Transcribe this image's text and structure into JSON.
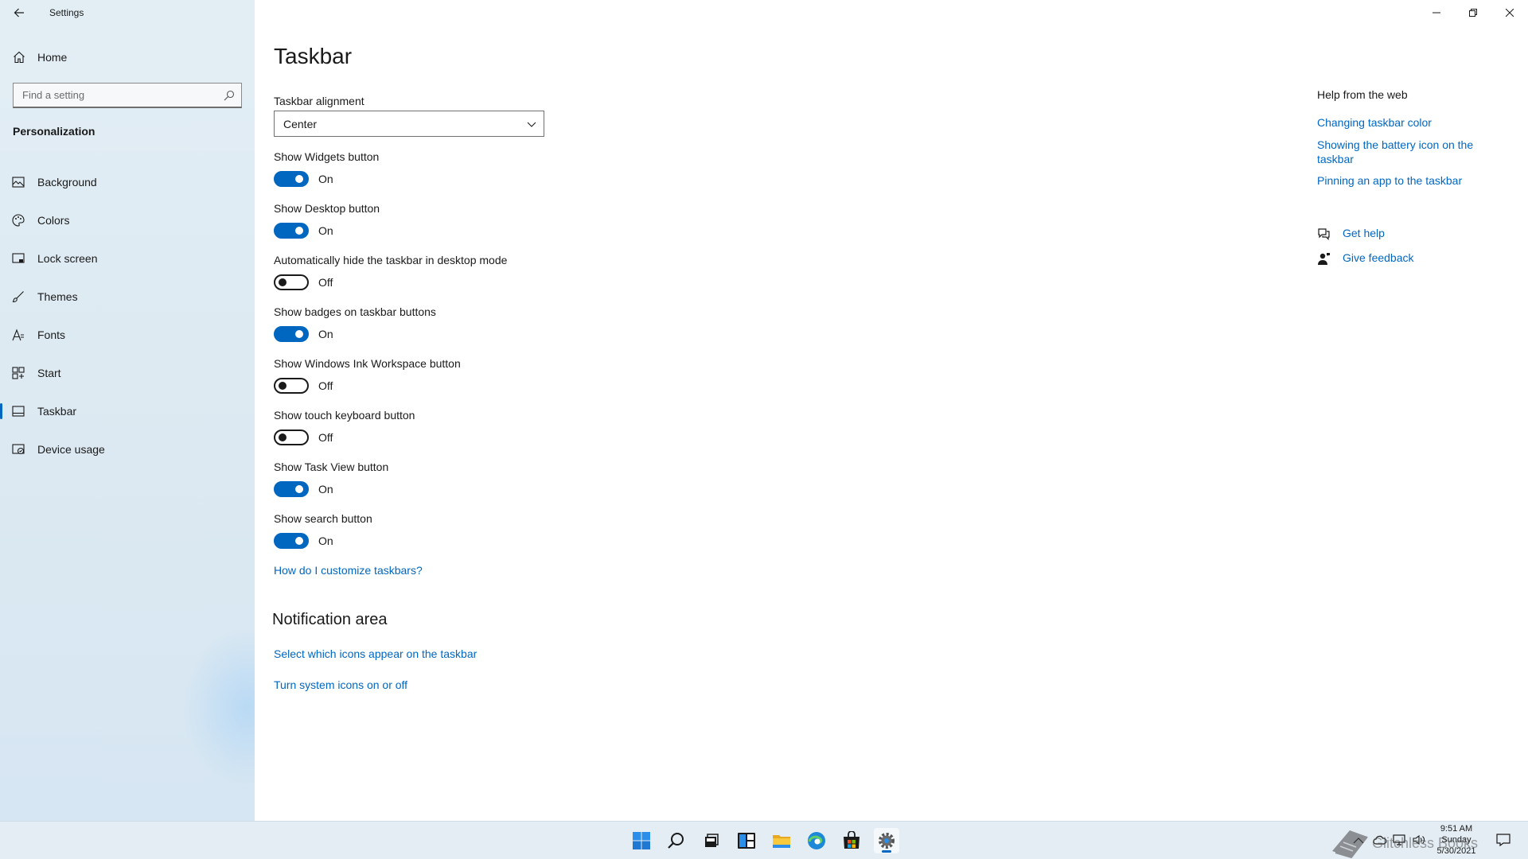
{
  "app": {
    "title": "Settings"
  },
  "sidebar": {
    "home_label": "Home",
    "search_placeholder": "Find a setting",
    "section": "Personalization",
    "items": [
      {
        "label": "Background",
        "icon": "picture-icon"
      },
      {
        "label": "Colors",
        "icon": "palette-icon"
      },
      {
        "label": "Lock screen",
        "icon": "lock-screen-icon"
      },
      {
        "label": "Themes",
        "icon": "brush-icon"
      },
      {
        "label": "Fonts",
        "icon": "font-icon"
      },
      {
        "label": "Start",
        "icon": "start-icon"
      },
      {
        "label": "Taskbar",
        "icon": "taskbar-icon",
        "selected": true
      },
      {
        "label": "Device usage",
        "icon": "device-usage-icon"
      }
    ]
  },
  "main": {
    "title": "Taskbar",
    "alignment": {
      "label": "Taskbar alignment",
      "value": "Center"
    },
    "toggles": [
      {
        "label": "Show Widgets button",
        "state": "On"
      },
      {
        "label": "Show Desktop button",
        "state": "On"
      },
      {
        "label": "Automatically hide the taskbar in desktop mode",
        "state": "Off"
      },
      {
        "label": "Show badges on taskbar buttons",
        "state": "On"
      },
      {
        "label": "Show Windows Ink Workspace button",
        "state": "Off"
      },
      {
        "label": "Show touch keyboard button",
        "state": "Off"
      },
      {
        "label": "Show Task View button",
        "state": "On"
      },
      {
        "label": "Show search button",
        "state": "On"
      }
    ],
    "customize_link": "How do I customize taskbars?",
    "notification": {
      "title": "Notification area",
      "links": [
        "Select which icons appear on the taskbar",
        "Turn system icons on or off"
      ]
    }
  },
  "help": {
    "title": "Help from the web",
    "links": [
      "Changing taskbar color",
      "Showing the battery icon on the taskbar",
      "Pinning an app to the taskbar"
    ],
    "get_help": "Get help",
    "give_feedback": "Give feedback"
  },
  "taskbar": {
    "apps": [
      "start-icon",
      "search-icon",
      "task-view-icon",
      "widgets-icon",
      "file-explorer-icon",
      "edge-icon",
      "store-icon",
      "settings-icon"
    ],
    "active": "settings-icon",
    "clock": {
      "time": "9:51 AM",
      "day": "Sunday",
      "date": "5/30/2021"
    },
    "watermark_text": "Glitchless Books"
  },
  "colors": {
    "accent": "#0067c0",
    "sidebar_bg": "#dce9f2",
    "taskbar_bg": "#e4edf4"
  }
}
